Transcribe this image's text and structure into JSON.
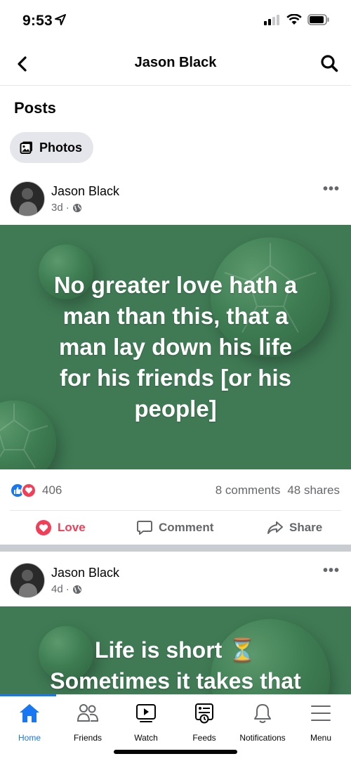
{
  "status": {
    "time": "9:53"
  },
  "nav": {
    "title": "Jason Black"
  },
  "section_title": "Posts",
  "chip": {
    "label": "Photos"
  },
  "posts": [
    {
      "author": "Jason Black",
      "time": "3d",
      "separator": "·",
      "quote_lines": [
        "No greater love hath a",
        "man than this, that a",
        "man lay down his life",
        "for his friends [or his",
        "people]"
      ],
      "reaction_count": "406",
      "comments": "8 comments",
      "shares": "48 shares",
      "actions": {
        "love": "Love",
        "comment": "Comment",
        "share": "Share"
      }
    },
    {
      "author": "Jason Black",
      "time": "4d",
      "separator": "·",
      "quote_lines": [
        "Life is short ⏳",
        "Sometimes it takes that"
      ]
    }
  ],
  "tabs": [
    {
      "label": "Home",
      "icon": "home-icon",
      "active": true
    },
    {
      "label": "Friends",
      "icon": "friends-icon",
      "active": false
    },
    {
      "label": "Watch",
      "icon": "watch-icon",
      "active": false
    },
    {
      "label": "Feeds",
      "icon": "feeds-icon",
      "active": false
    },
    {
      "label": "Notifications",
      "icon": "bell-icon",
      "active": false
    },
    {
      "label": "Menu",
      "icon": "menu-icon",
      "active": false
    }
  ],
  "colors": {
    "accent": "#1877f2",
    "love": "#f33e58",
    "post_bg": "#3f7a54"
  }
}
